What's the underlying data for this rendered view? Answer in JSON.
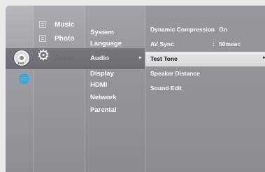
{
  "categories": [
    {
      "id": "music",
      "label": "Music",
      "icon": "music-icon"
    },
    {
      "id": "photo",
      "label": "Photo",
      "icon": "photo-icon"
    },
    {
      "id": "setup",
      "label": "Setup",
      "icon": "gear-icon",
      "selected": true
    }
  ],
  "left_icons": {
    "disc_label": "DVD",
    "disc_icon": "disc-icon",
    "globe_icon": "globe-icon"
  },
  "menu": {
    "items": [
      {
        "label": "System"
      },
      {
        "label": "Language"
      },
      {
        "label": "Audio",
        "selected": true
      },
      {
        "label": "Display"
      },
      {
        "label": "HDMI"
      },
      {
        "label": "Network"
      },
      {
        "label": "Parental"
      }
    ]
  },
  "detail": {
    "items": [
      {
        "label": "Dynamic Compression",
        "separator": ":",
        "value": "On"
      },
      {
        "label": "AV Sync",
        "separator": ":",
        "value": "50msec"
      },
      {
        "label": "Test Tone",
        "highlighted": true
      },
      {
        "label": "Speaker Distance"
      },
      {
        "label": "Sound Edit"
      }
    ]
  },
  "colors": {
    "page_background": "#e9e9ea",
    "panel": "#8e8f94",
    "selection_band": "#6e6f74",
    "highlight_row": "#e2e2e4",
    "text": "#ffffff",
    "highlight_text": "#111111"
  }
}
